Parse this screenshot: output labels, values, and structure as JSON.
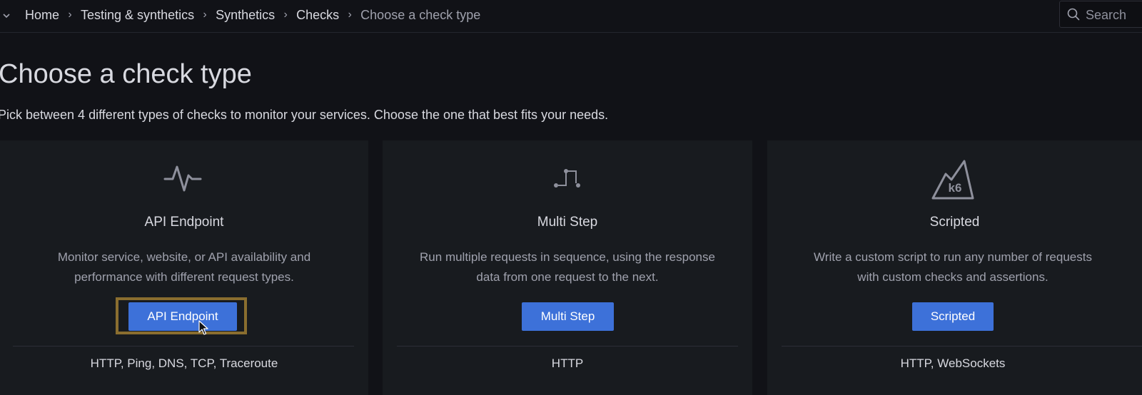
{
  "breadcrumb": {
    "items": [
      "Home",
      "Testing & synthetics",
      "Synthetics",
      "Checks"
    ],
    "current": "Choose a check type",
    "separator": "›"
  },
  "search": {
    "text": "Search"
  },
  "page": {
    "title": "Choose a check type",
    "subtitle": "Pick between 4 different types of checks to monitor your services. Choose the one that best fits your needs."
  },
  "cards": [
    {
      "icon": "activity-pulse-icon",
      "title": "API Endpoint",
      "description_lines": [
        "Monitor service, website, or API availability and",
        "performance with different request types."
      ],
      "button_label": "API Endpoint",
      "footer": "HTTP, Ping, DNS, TCP, Traceroute",
      "highlighted": true
    },
    {
      "icon": "multi-step-icon",
      "title": "Multi Step",
      "description_lines": [
        "Run multiple requests in sequence, using the response",
        "data from one request to the next."
      ],
      "button_label": "Multi Step",
      "footer": "HTTP",
      "highlighted": false
    },
    {
      "icon": "k6-logo-icon",
      "title": "Scripted",
      "description_lines": [
        "Write a custom script to run any number of requests",
        "with custom checks and assertions."
      ],
      "button_label": "Scripted",
      "footer": "HTTP, WebSockets",
      "highlighted": false
    }
  ],
  "colors": {
    "background": "#111217",
    "card": "#181b1f",
    "primary_button": "#3d71d9",
    "highlight_frame": "#8a6e2f"
  }
}
